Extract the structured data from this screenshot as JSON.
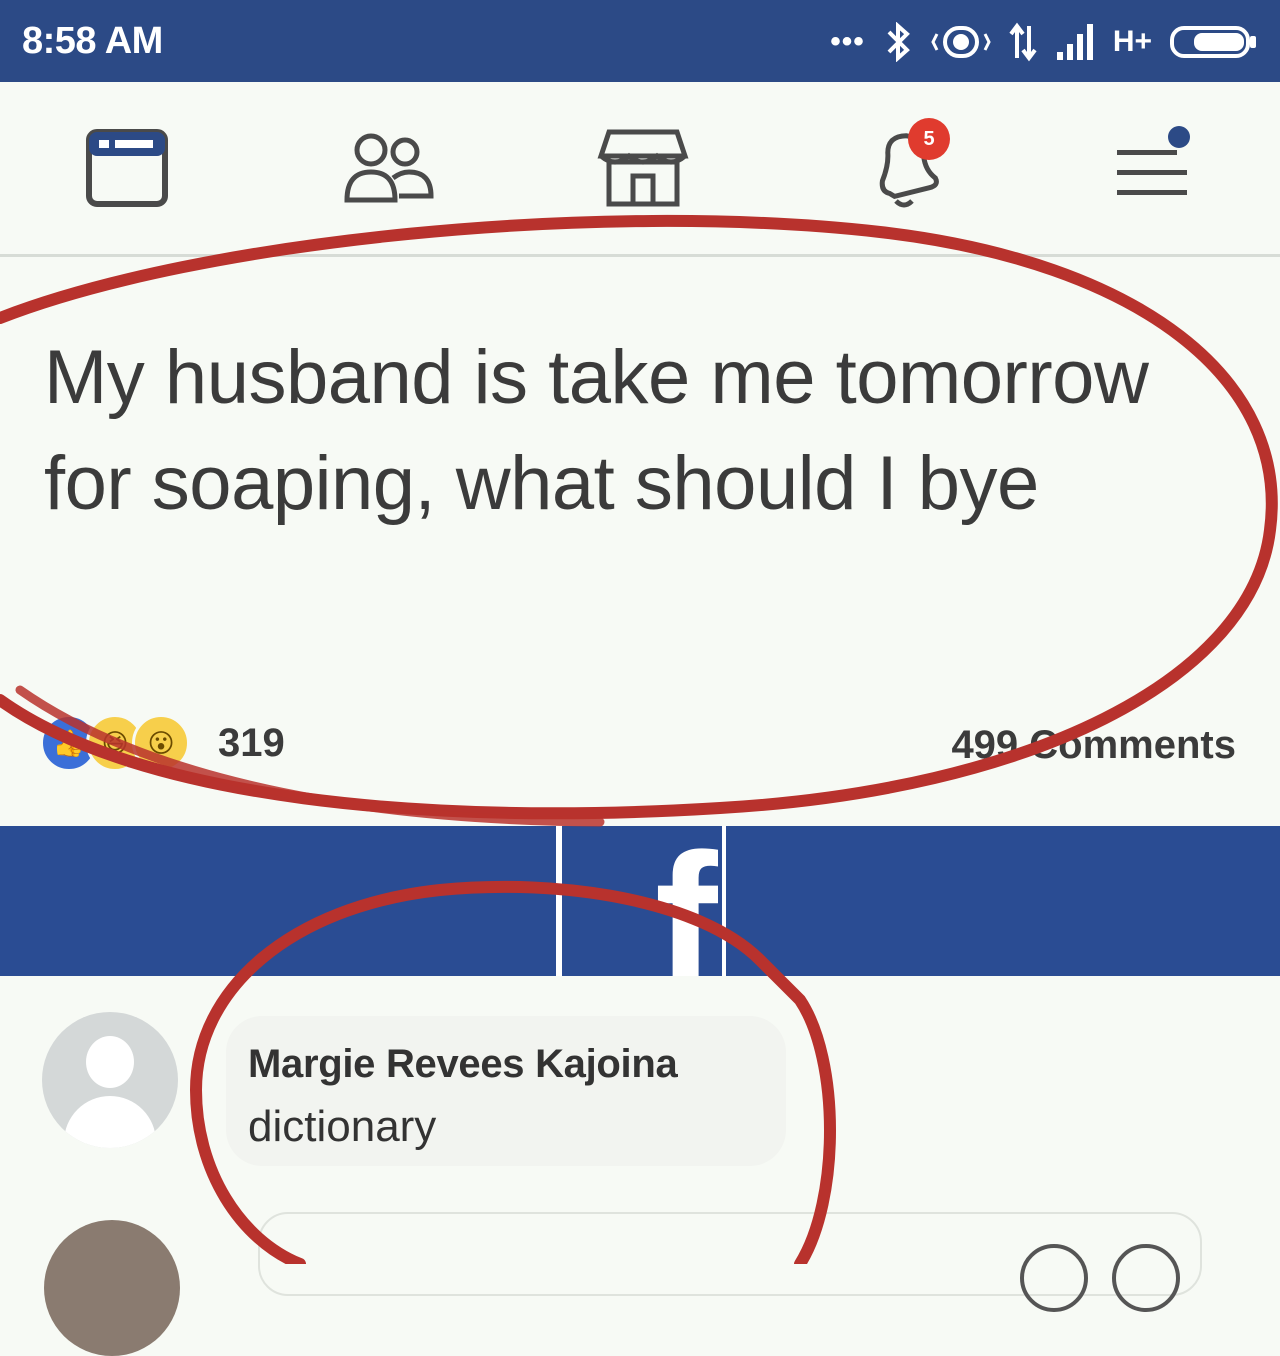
{
  "status_bar": {
    "time": "8:58 AM",
    "network_label": "H+",
    "icons": [
      "more-dots-icon",
      "bluetooth-icon",
      "vibrate-icon",
      "data-arrows-icon",
      "signal-icon",
      "battery-icon"
    ]
  },
  "nav": {
    "items": [
      {
        "name": "news-feed-icon"
      },
      {
        "name": "friends-icon"
      },
      {
        "name": "marketplace-icon"
      },
      {
        "name": "notifications-icon",
        "badge": "5"
      },
      {
        "name": "menu-icon"
      }
    ]
  },
  "post": {
    "text": "My husband is take me tomorrow for soaping, what should I bye",
    "reaction_count": "319",
    "comment_count": "499 Comments",
    "reaction_icons": [
      "like-icon",
      "haha-icon",
      "wow-icon"
    ]
  },
  "banner": {
    "logo_letter": "f"
  },
  "comment": {
    "author": "Margie Revees Kajoina",
    "body": "dictionary"
  },
  "colors": {
    "brand_blue": "#2a4c93",
    "status_bar": "#2c4a86",
    "annotation_red": "#b8322d",
    "badge_red": "#e03b2e"
  }
}
